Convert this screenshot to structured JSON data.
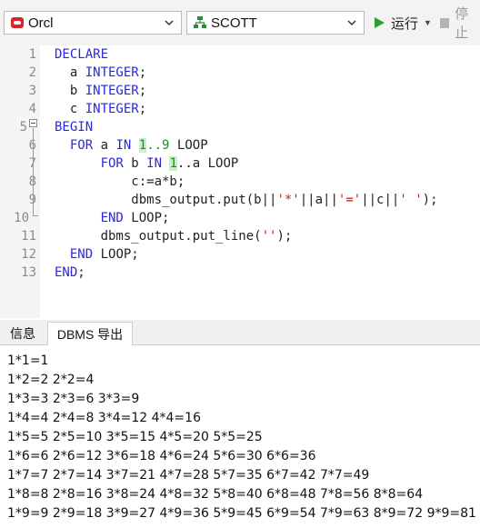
{
  "toolbar": {
    "connection": "Orcl",
    "schema": "SCOTT",
    "run_label": "运行",
    "stop_label": "停止"
  },
  "editor": {
    "line_numbers": [
      "1",
      "2",
      "3",
      "4",
      "5",
      "6",
      "7",
      "8",
      "9",
      "10",
      "11",
      "12",
      "13"
    ]
  },
  "tabs": {
    "info": "信息",
    "dbms_output": "DBMS 导出"
  },
  "output": {
    "lines": [
      "1*1=1",
      "1*2=2 2*2=4",
      "1*3=3 2*3=6 3*3=9",
      "1*4=4 2*4=8 3*4=12 4*4=16",
      "1*5=5 2*5=10 3*5=15 4*5=20 5*5=25",
      "1*6=6 2*6=12 3*6=18 4*6=24 5*6=30 6*6=36",
      "1*7=7 2*7=14 3*7=21 4*7=28 5*7=35 6*7=42 7*7=49",
      "1*8=8 2*8=16 3*8=24 4*8=32 5*8=40 6*8=48 7*8=56 8*8=64",
      "1*9=9 2*9=18 3*9=27 4*9=36 5*9=45 6*9=54 7*9=63 8*9=72 9*9=81"
    ]
  },
  "colors": {
    "keyword": "#2a2ad6",
    "number": "#17901f",
    "string": "#c41a16",
    "run_icon": "#2e9e2e"
  },
  "icons": [
    "oracle-connection-icon",
    "schema-icon",
    "chevron-down-icon",
    "play-icon",
    "stop-icon"
  ]
}
